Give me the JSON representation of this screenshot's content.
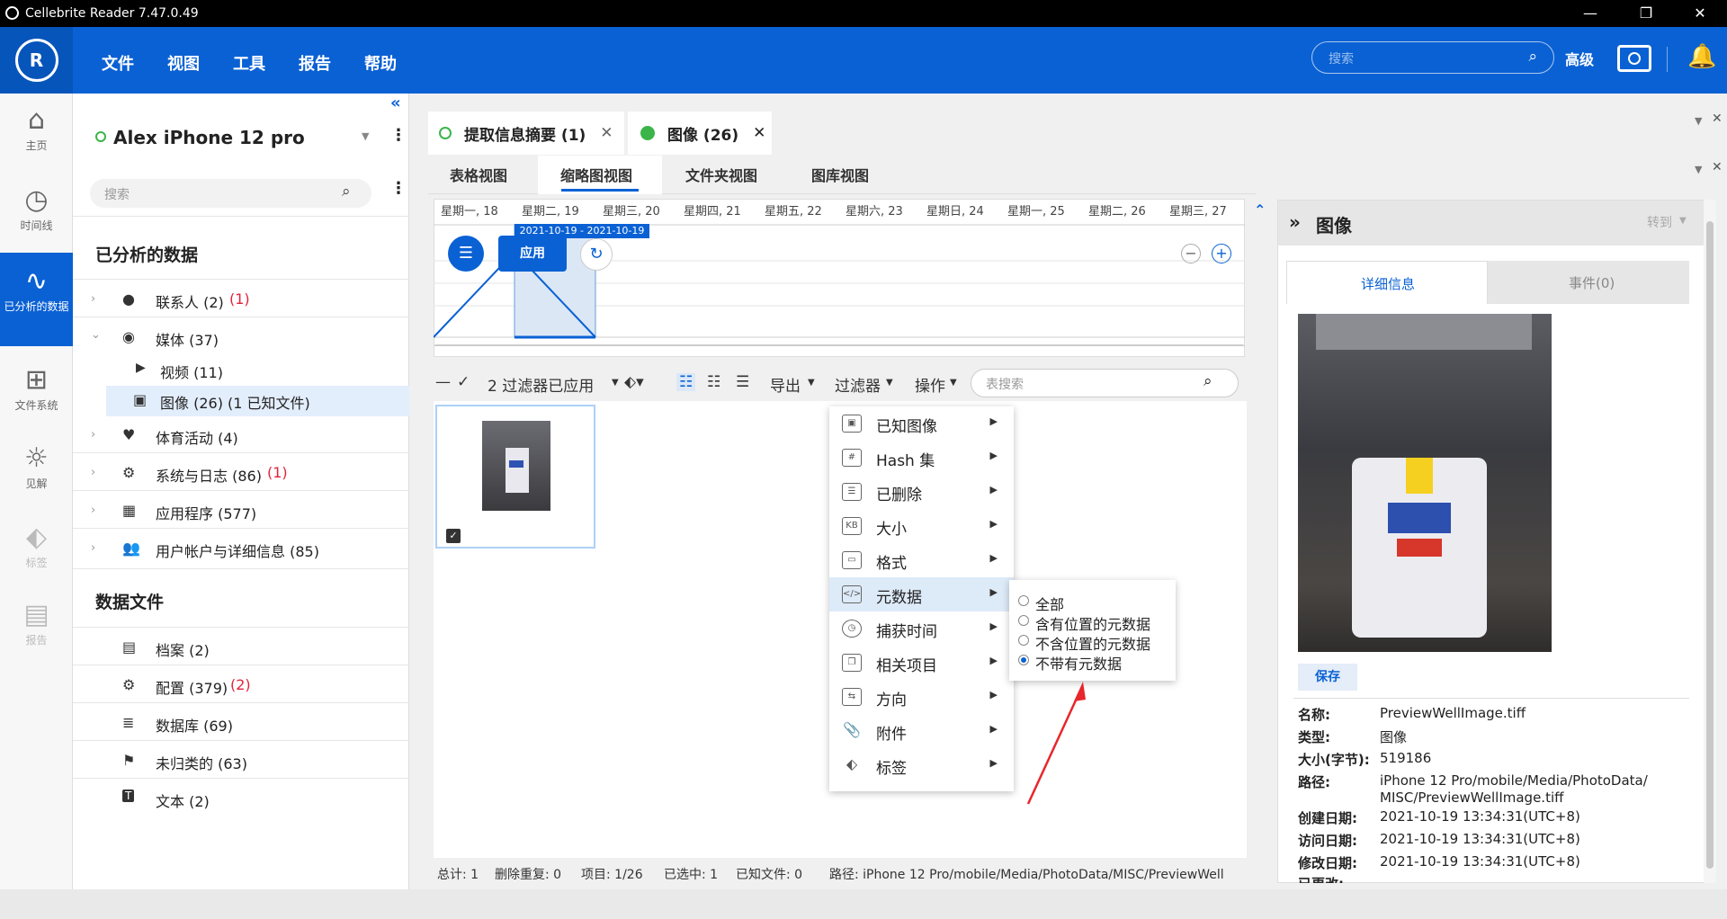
{
  "window": {
    "title": "Cellebrite Reader 7.47.0.49",
    "minimize": "—",
    "restore": "❐",
    "close": "✕"
  },
  "menu": [
    "文件",
    "视图",
    "工具",
    "报告",
    "帮助"
  ],
  "search": {
    "placeholder": "搜索",
    "advanced": "高级"
  },
  "rail": [
    {
      "label": "主页",
      "icon": "home-icon"
    },
    {
      "label": "时间线",
      "icon": "clock-icon"
    },
    {
      "label": "已分析的数据",
      "icon": "pulse-icon"
    },
    {
      "label": "文件系统",
      "icon": "filesystem-icon"
    },
    {
      "label": "见解",
      "icon": "lightbulb-icon"
    },
    {
      "label": "标签",
      "icon": "tag-icon"
    },
    {
      "label": "报告",
      "icon": "report-icon"
    }
  ],
  "nav": {
    "device": "Alex iPhone 12 pro",
    "search_placeholder": "搜索",
    "analyzed_title": "已分析的数据",
    "items": [
      {
        "label": "联系人 (2)",
        "badge": "(1)"
      },
      {
        "label": "媒体 (37)",
        "badge": ""
      },
      {
        "label": "视频 (11)",
        "badge": ""
      },
      {
        "label": "图像 (26)  (1 已知文件)",
        "badge": ""
      },
      {
        "label": "体育活动 (4)",
        "badge": ""
      },
      {
        "label": "系统与日志 (86)",
        "badge": "(1)"
      },
      {
        "label": "应用程序 (577)",
        "badge": ""
      },
      {
        "label": "用户帐户与详细信息 (85)",
        "badge": ""
      }
    ],
    "files_title": "数据文件",
    "files": [
      {
        "label": "档案 (2)",
        "badge": ""
      },
      {
        "label": "配置 (379)",
        "badge": "(2)"
      },
      {
        "label": "数据库 (69)",
        "badge": ""
      },
      {
        "label": "未归类的 (63)",
        "badge": ""
      },
      {
        "label": "文本 (2)",
        "badge": ""
      }
    ]
  },
  "tabs": [
    {
      "label": "提取信息摘要 (1)"
    },
    {
      "label": "图像 (26)"
    }
  ],
  "subtabs": [
    "表格视图",
    "缩略图视图",
    "文件夹视图",
    "图库视图"
  ],
  "timeline": {
    "days": [
      "星期一, 18",
      "星期二, 19",
      "星期三, 20",
      "星期四, 21",
      "星期五, 22",
      "星期六, 23",
      "星期日, 24",
      "星期一, 25",
      "星期二, 26",
      "星期三, 27"
    ],
    "range": "2021-10-19 - 2021-10-19",
    "apply": "应用"
  },
  "toolbar": {
    "filters_applied": "2 过滤器已应用",
    "export": "导出",
    "filter": "过滤器",
    "actions": "操作",
    "table_search": "表搜索"
  },
  "filter_menu": [
    "已知图像",
    "Hash 集",
    "已删除",
    "大小",
    "格式",
    "元数据",
    "捕获时间",
    "相关项目",
    "方向",
    "附件",
    "标签"
  ],
  "metadata_submenu": {
    "options": [
      "全部",
      "含有位置的元数据",
      "不含位置的元数据",
      "不带有元数据"
    ],
    "selected": 3
  },
  "status": {
    "total": "总计: 1",
    "dedup": "删除重复: 0",
    "items": "项目: 1/26",
    "selected": "已选中: 1",
    "known": "已知文件:   0",
    "path": "路径: iPhone 12 Pro/mobile/Media/PhotoData/MISC/PreviewWell"
  },
  "right_panel": {
    "title": "图像",
    "goto": "转到",
    "tab_details": "详细信息",
    "tab_events": "事件(0)",
    "save": "保存",
    "fields": [
      {
        "k": "名称:",
        "v": "PreviewWellImage.tiff"
      },
      {
        "k": "类型:",
        "v": "图像"
      },
      {
        "k": "大小(字节):",
        "v": "519186"
      },
      {
        "k": "路径:",
        "v": "iPhone 12 Pro/mobile/Media/PhotoData/"
      },
      {
        "k": "",
        "v": "MISC/PreviewWellImage.tiff"
      },
      {
        "k": "创建日期:",
        "v": "2021-10-19 13:34:31(UTC+8)"
      },
      {
        "k": "访问日期:",
        "v": "2021-10-19 13:34:31(UTC+8)"
      },
      {
        "k": "修改日期:",
        "v": "2021-10-19 13:34:31(UTC+8)"
      },
      {
        "k": "已更改:",
        "v": ""
      }
    ]
  },
  "colors": {
    "brand": "#0a61d4",
    "header_dark": "#0655bb",
    "badge_red": "#e0223a",
    "status_green": "#3bb54a"
  }
}
